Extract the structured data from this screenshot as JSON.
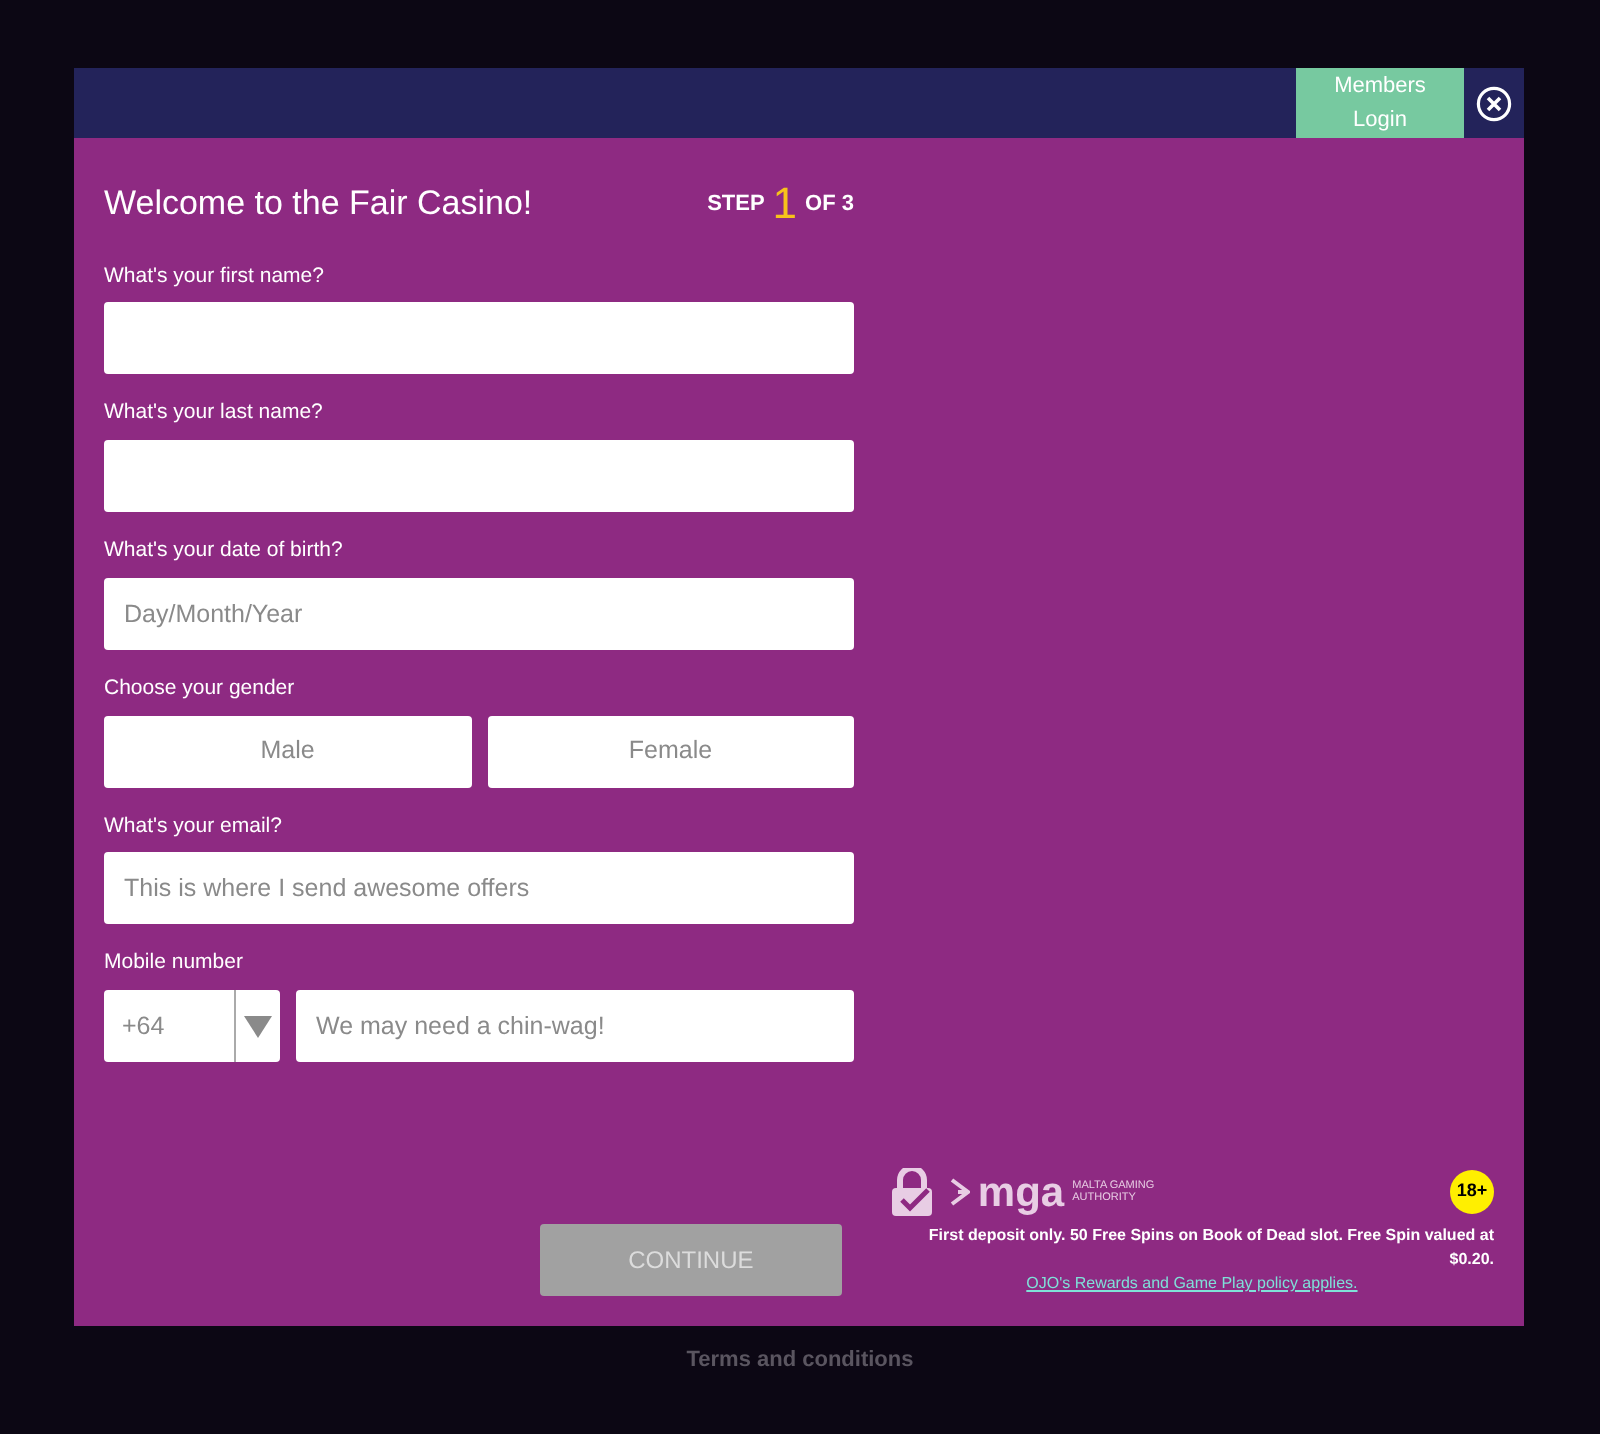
{
  "header": {
    "members_login": "Members Login"
  },
  "form": {
    "title": "Welcome to the Fair Casino!",
    "step": {
      "prefix": "STEP",
      "current": "1",
      "suffix": "OF 3"
    },
    "fields": [
      {
        "kind": "text",
        "label": "What's your first name?"
      },
      {
        "kind": "text",
        "label": "What's your last name?"
      },
      {
        "kind": "text",
        "label": "What's your date of birth?",
        "placeholder": "Day/Month/Year"
      },
      {
        "kind": "choice",
        "label": "Choose your gender",
        "options": [
          {
            "label": "Male",
            "selected": false
          },
          {
            "label": "Female",
            "selected": false
          }
        ]
      },
      {
        "kind": "text",
        "label": "What's your email?",
        "placeholder": "This is where I send awesome offers"
      },
      {
        "kind": "phone",
        "label": "Mobile number",
        "code": "+64",
        "placeholder": "We may need a chin-wag!"
      }
    ],
    "continue": {
      "label": "CONTINUE",
      "disabled": true
    }
  },
  "footer": {
    "regulator": "mga",
    "regulator_name": "MALTA GAMING AUTHORITY",
    "age": "18+",
    "offer": "First deposit only. 50 Free Spins on Book of Dead slot. Free Spin valued at $0.20.",
    "policy_link": "OJO's Rewards and Game Play policy applies."
  },
  "page": {
    "terms_heading": "Terms and conditions"
  }
}
